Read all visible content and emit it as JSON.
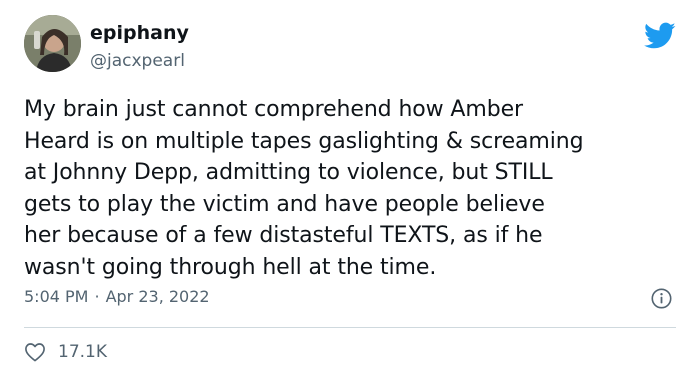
{
  "author": {
    "display_name": "epiphany",
    "handle": "@jacxpearl"
  },
  "tweet": {
    "text": "My brain just cannot comprehend how Amber\nHeard is on multiple tapes gaslighting & screaming\nat Johnny Depp, admitting to violence, but STILL\ngets to play the victim and have people believe\nher because of a few distasteful TEXTS, as if he\nwasn't going through hell at the time.",
    "time": "5:04 PM",
    "separator": "·",
    "date": "Apr 23, 2022",
    "likes": "17.1K"
  },
  "icons": {
    "brand": "twitter-bird-icon",
    "info": "info-icon",
    "like": "heart-icon"
  },
  "colors": {
    "twitter_blue": "#1d9bf0",
    "text_primary": "#0f1419",
    "text_secondary": "#536471",
    "divider": "#cfd9de"
  }
}
